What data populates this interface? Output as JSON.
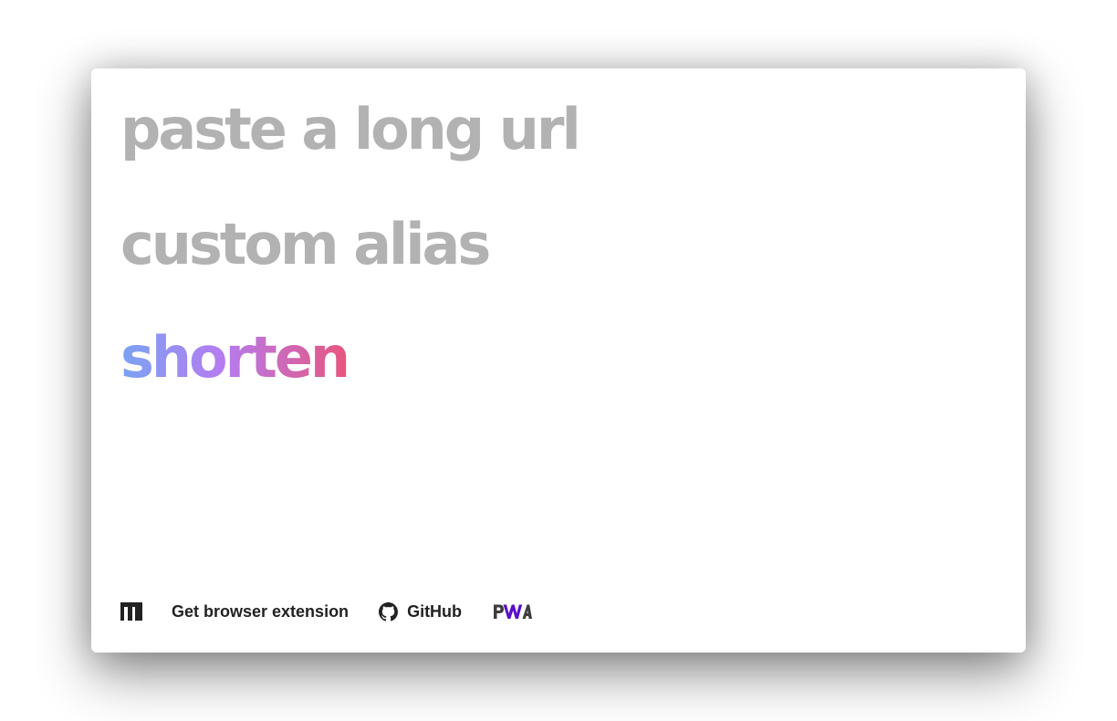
{
  "form": {
    "url_placeholder": "paste a long url",
    "url_value": "",
    "alias_placeholder": "custom alias",
    "alias_value": "",
    "shorten_label": "shorten"
  },
  "footer": {
    "logo_icon": "m-logo-icon",
    "extension_label": "Get browser extension",
    "github_icon": "github-icon",
    "github_label": "GitHub",
    "pwa_icon": "pwa-icon"
  },
  "colors": {
    "placeholder": "#b2b2b2",
    "gradient_start": "#7aa3f2",
    "gradient_mid": "#b57cf0",
    "gradient_end": "#e8557c",
    "pwa_accent": "#5a0fc8"
  }
}
